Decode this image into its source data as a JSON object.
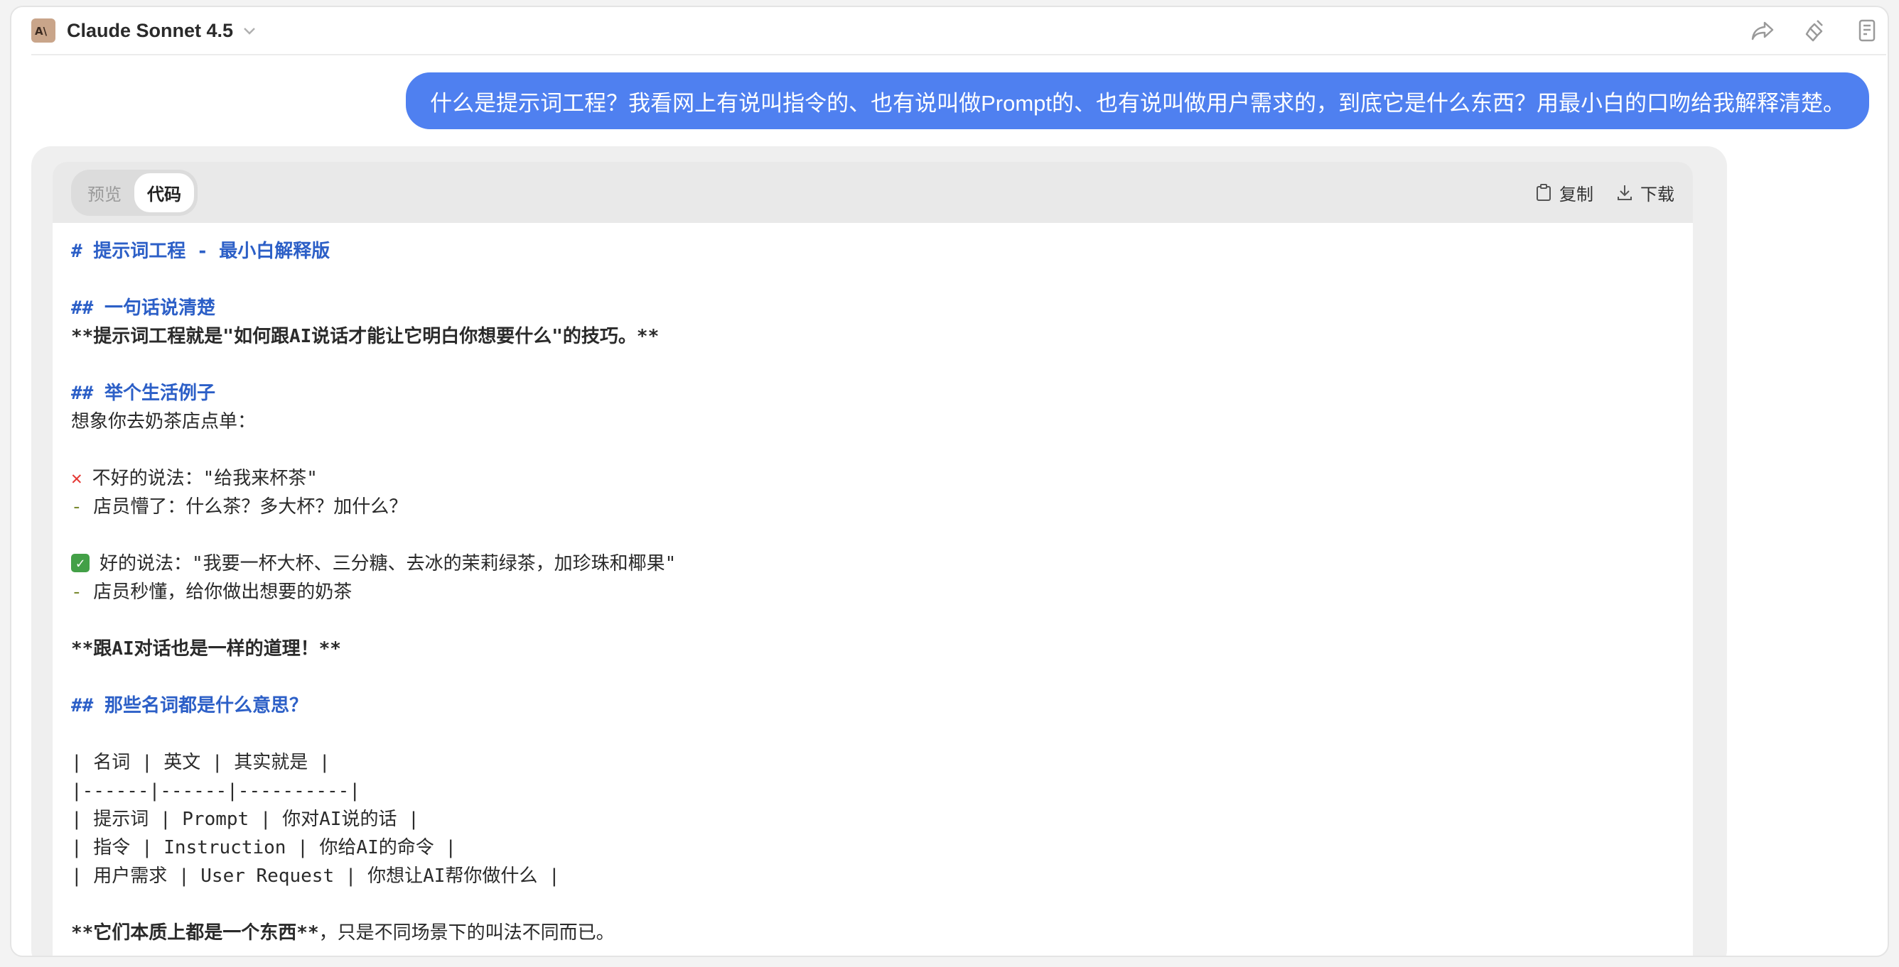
{
  "header": {
    "model_name": "Claude Sonnet 4.5",
    "icons": [
      "share-icon",
      "clear-icon",
      "notes-icon"
    ]
  },
  "user_message": "什么是提示词工程？我看网上有说叫指令的、也有说叫做Prompt的、也有说叫做用户需求的，到底它是什么东西？用最小白的口吻给我解释清楚。",
  "code_panel": {
    "tabs": [
      "预览",
      "代码"
    ],
    "active_tab": "代码",
    "copy_label": "复制",
    "download_label": "下载",
    "lines": {
      "l1": "# 提示词工程 - 最小白解释版",
      "l2": "## 一句话说清楚",
      "l3": "**提示词工程就是\"如何跟AI说话才能让它明白你想要什么\"的技巧。**",
      "l4": "## 举个生活例子",
      "l5": "想象你去奶茶店点单：",
      "l6": "不好的说法：\"给我来杯茶\"",
      "l7_dash": "-",
      "l7": " 店员懵了：什么茶？多大杯？加什么？",
      "l8": "好的说法：\"我要一杯大杯、三分糖、去冰的茉莉绿茶，加珍珠和椰果\"",
      "l9_dash": "-",
      "l9": " 店员秒懂，给你做出想要的奶茶",
      "l10": "**跟AI对话也是一样的道理！**",
      "l11": "## 那些名词都是什么意思？",
      "l12": "| 名词 | 英文 | 其实就是 |",
      "l13": "|------|------|----------|",
      "l14": "| 提示词 | Prompt | 你对AI说的话 |",
      "l15": "| 指令 | Instruction | 你给AI的命令 |",
      "l16": "| 用户需求 | User Request | 你想让AI帮你做什么 |",
      "l17_bold": "**它们本质上都是一个东西**",
      "l17_rest": "，只是不同场景下的叫法不同而已。"
    }
  }
}
